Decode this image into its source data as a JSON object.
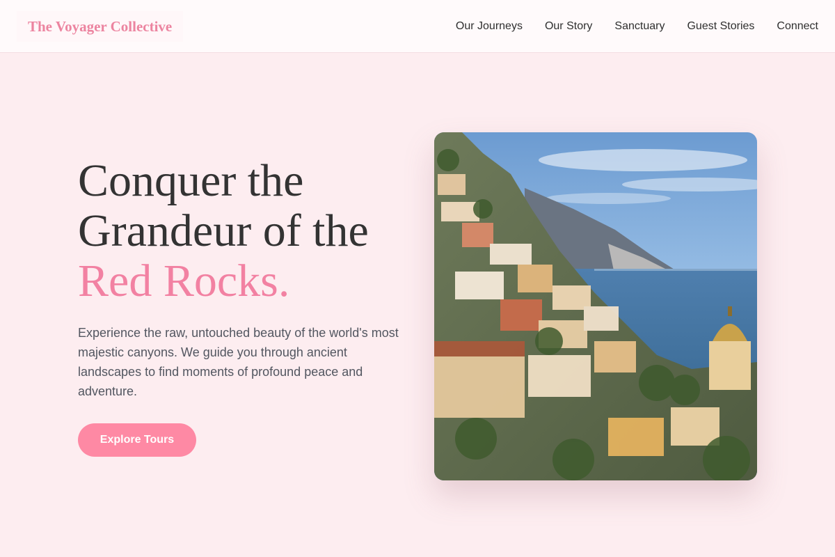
{
  "brand": {
    "name": "The Voyager Collective"
  },
  "nav": {
    "items": [
      {
        "label": "Our Journeys"
      },
      {
        "label": "Our Story"
      },
      {
        "label": "Sanctuary"
      },
      {
        "label": "Guest Stories"
      },
      {
        "label": "Connect"
      }
    ]
  },
  "hero": {
    "title_line1": "Conquer the",
    "title_line2": "Grandeur of the",
    "title_accent": "Red Rocks.",
    "description": "Experience the raw, untouched beauty of the world's most majestic canyons. We guide you through ancient landscapes to find moments of profound peace and adventure.",
    "cta_label": "Explore Tours",
    "image_subject": "cliffside coastal village above the sea"
  },
  "colors": {
    "background": "#fdedf0",
    "header_background": "#fffafb",
    "accent": "#f281a2",
    "button": "#fe89a4",
    "heading_text": "#333333",
    "body_text": "#525660"
  }
}
